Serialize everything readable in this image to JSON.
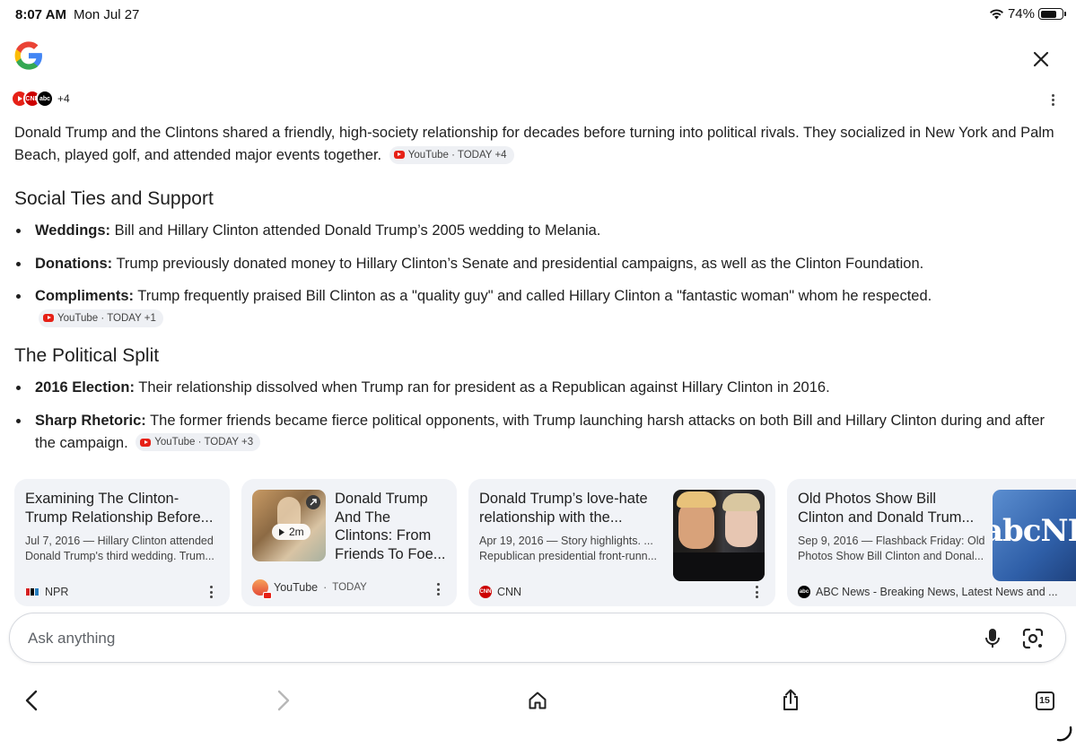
{
  "status_bar": {
    "time": "8:07 AM",
    "date": "Mon Jul 27",
    "battery": "74%",
    "battery_level": 0.74
  },
  "sources": {
    "more": "+4"
  },
  "overview": {
    "intro": "Donald Trump and the Clintons shared a friendly, high-society relationship for decades before turning into political rivals. They socialized in New York and Palm Beach, played golf, and attended major events together.",
    "intro_chip": "YouTube · TODAY +4",
    "sections": [
      {
        "heading": "Social Ties and Support",
        "bullets": [
          {
            "label": "Weddings:",
            "text": " Bill and Hillary Clinton attended Donald Trump’s 2005 wedding to Melania."
          },
          {
            "label": "Donations:",
            "text": " Trump previously donated money to Hillary Clinton’s Senate and presidential campaigns, as well as the Clinton Foundation."
          },
          {
            "label": "Compliments:",
            "text": " Trump frequently praised Bill Clinton as a \"quality guy\" and called Hillary Clinton a \"fantastic woman\" whom he respected.",
            "chip": "YouTube · TODAY +1"
          }
        ]
      },
      {
        "heading": "The Political Split",
        "bullets": [
          {
            "label": "2016 Election:",
            "text": " Their relationship dissolved when Trump ran for president as a Republican against Hillary Clinton in 2016."
          },
          {
            "label": "Sharp Rhetoric:",
            "text": " The former friends became fierce political opponents, with Trump launching harsh attacks on both Bill and Hillary Clinton during and after the campaign.",
            "chip": "YouTube · TODAY +3"
          }
        ]
      }
    ]
  },
  "cards": [
    {
      "title": "Examining The Clinton-Trump Relationship Before...",
      "meta": "Jul 7, 2016 — Hillary Clinton attended Donald Trump's third wedding. Trum...",
      "source": "NPR",
      "favicon": "npr-icon"
    },
    {
      "title": "Donald Trump And The Clintons: From Friends To Foe...",
      "duration": "2m",
      "source": "YouTube",
      "source_time": "TODAY",
      "favicon": "youtube-icon"
    },
    {
      "title": "Donald Trump’s love-hate relationship with the...",
      "meta": "Apr 19, 2016 — Story highlights. ... Republican presidential front-runn...",
      "source": "CNN",
      "favicon": "cnn-icon"
    },
    {
      "title": "Old Photos Show Bill Clinton and Donald Trum...",
      "meta": "Sep 9, 2016 — Flashback Friday: Old Photos Show Bill Clinton and Donal...",
      "source": "ABC News - Breaking News, Latest News and ...",
      "favicon": "abc-icon",
      "thumb_text": "abcNE"
    }
  ],
  "ask": {
    "placeholder": "Ask anything"
  },
  "toolbar": {
    "tab_count": "15"
  },
  "colors": {
    "youtube_red": "#e62117",
    "card_bg": "#f1f3f7",
    "text": "#1f1f1f",
    "chip_bg": "#eef0f4"
  }
}
